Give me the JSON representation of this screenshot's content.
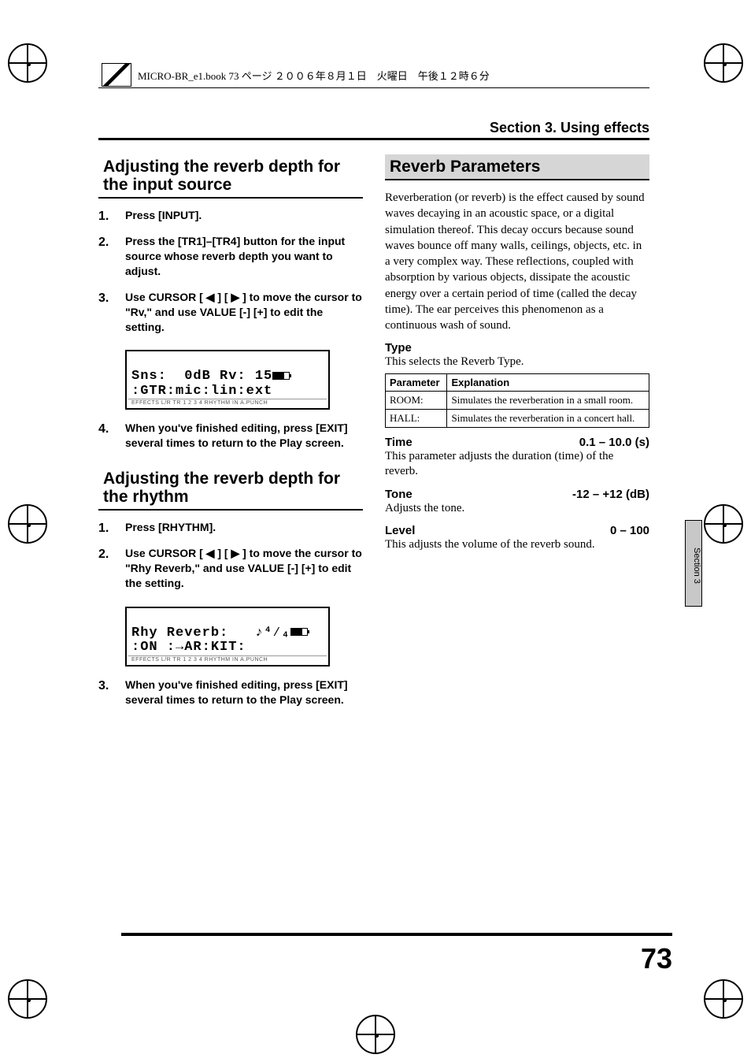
{
  "meta_line": "MICRO-BR_e1.book 73 ページ ２００６年８月１日　火曜日　午後１２時６分",
  "section_title": "Section 3. Using effects",
  "side_tab": "Section 3",
  "page_number": "73",
  "left": {
    "h1": "Adjusting the reverb depth for the input source",
    "steps1": [
      "Press [INPUT].",
      "Press the [TR1]–[TR4] button for the input source whose reverb depth you want to adjust.",
      "Use CURSOR [ ◀ ] [ ▶ ] to move the cursor to \"Rv,\" and use VALUE [-] [+] to edit the setting.",
      "When you've finished editing, press [EXIT] several times to return to the Play screen."
    ],
    "lcd1_line1": "Sns:  0dB Rv: 15",
    "lcd1_line2": ":GTR:mic:lin:ext",
    "lcd_status": "EFFECTS L/R TR 1 2 3 4  RHYTHM         IN A.PUNCH",
    "h2": "Adjusting the reverb depth for the rhythm",
    "steps2": [
      "Press [RHYTHM].",
      "Use CURSOR [ ◀ ] [ ▶ ] to move the cursor to \"Rhy Reverb,\" and use VALUE [-] [+] to edit the setting.",
      "When you've finished editing, press [EXIT] several times to return to the Play screen."
    ],
    "lcd2_line1": "Rhy Reverb:",
    "lcd2_line2": ":ON :→AR:KIT:",
    "lcd2_icon": "♪⁴⁄₄"
  },
  "right": {
    "h1": "Reverb Parameters",
    "intro": "Reverberation (or reverb) is the effect caused by sound waves decaying in an acoustic space, or a digital simulation thereof. This decay occurs because sound waves bounce off many walls, ceilings, objects, etc. in a very complex way. These reflections, coupled with absorption by various objects, dissipate the acoustic energy over a certain period of time (called the decay time). The ear perceives this phenomenon as a continuous wash of sound.",
    "type_head": "Type",
    "type_desc": "This selects the Reverb Type.",
    "table_head": [
      "Parameter",
      "Explanation"
    ],
    "table_rows": [
      [
        "ROOM:",
        "Simulates the reverberation in a small room."
      ],
      [
        "HALL:",
        "Simulates the reverberation in a concert hall."
      ]
    ],
    "time_label": "Time",
    "time_range": "0.1 – 10.0 (s)",
    "time_desc": "This parameter adjusts the duration (time) of the reverb.",
    "tone_label": "Tone",
    "tone_range": "-12 – +12 (dB)",
    "tone_desc": "Adjusts the tone.",
    "level_label": "Level",
    "level_range": "0 – 100",
    "level_desc": "This adjusts the volume of the reverb sound."
  }
}
